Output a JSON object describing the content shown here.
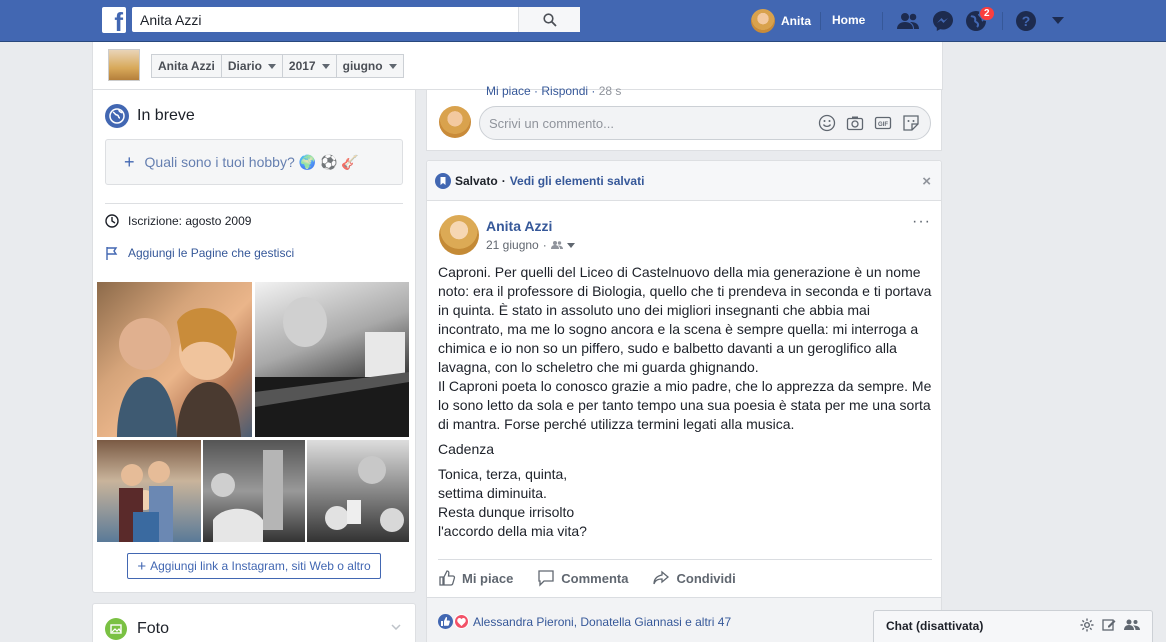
{
  "topbar": {
    "logo": "f",
    "search_value": "Anita Azzi",
    "user_name": "Anita",
    "home_label": "Home",
    "notifications_count": "2"
  },
  "subheader": {
    "crumbs": [
      "Anita Azzi",
      "Diario",
      "2017",
      "giugno"
    ]
  },
  "intro": {
    "title": "In breve",
    "prompt": "Quali sono i tuoi hobby? 🌍 ⚽ 🎸",
    "joined": "Iscrizione: agosto 2009",
    "add_pages": "Aggiungi le Pagine che gestisci",
    "add_links": "Aggiungi link a Instagram, siti Web o altro"
  },
  "photos_section": {
    "title": "Foto"
  },
  "comment_box": {
    "prev_like": "Mi piace",
    "prev_reply": "Rispondi",
    "prev_time": "28 s",
    "placeholder": "Scrivi un commento..."
  },
  "saved_bar": {
    "saved": "Salvato",
    "separator": "·",
    "see_saved": "Vedi gli elementi salvati",
    "close": "×"
  },
  "post": {
    "author": "Anita Azzi",
    "date": "21 giugno",
    "dot": "·",
    "menu": "···",
    "paragraph1": "Caproni. Per quelli del Liceo di Castelnuovo della mia generazione è un nome noto: era il professore di Biologia, quello che ti prendeva in seconda e ti portava in quinta. È stato in assoluto uno dei migliori insegnanti che abbia mai incontrato, ma me lo sogno ancora e la scena è sempre quella: mi interroga a chimica e io non so un piffero, sudo e balbetto davanti a un geroglifico alla lavagna, con lo scheletro che mi guarda ghignando.",
    "paragraph2": "Il Caproni poeta lo conosco grazie a mio padre, che lo apprezza da sempre. Me lo sono letto da sola e per tanto tempo una sua poesia è stata per me una sorta di mantra. Forse perché utilizza termini legati alla musica.",
    "poem_title": "Cadenza",
    "poem_lines": [
      "Tonica, terza, quinta,",
      "settima diminuita.",
      "Resta dunque irrisolto",
      "l'accordo della mia vita?"
    ],
    "actions": {
      "like": "Mi piace",
      "comment": "Commenta",
      "share": "Condividi"
    },
    "reactions_text": "Alessandra Pieroni, Donatella Giannasi e altri 47"
  },
  "chat": {
    "label": "Chat (disattivata)"
  },
  "colors": {
    "brand_blue": "#4267b2",
    "link_blue": "#365899",
    "badge_red": "#fa3e3e"
  }
}
